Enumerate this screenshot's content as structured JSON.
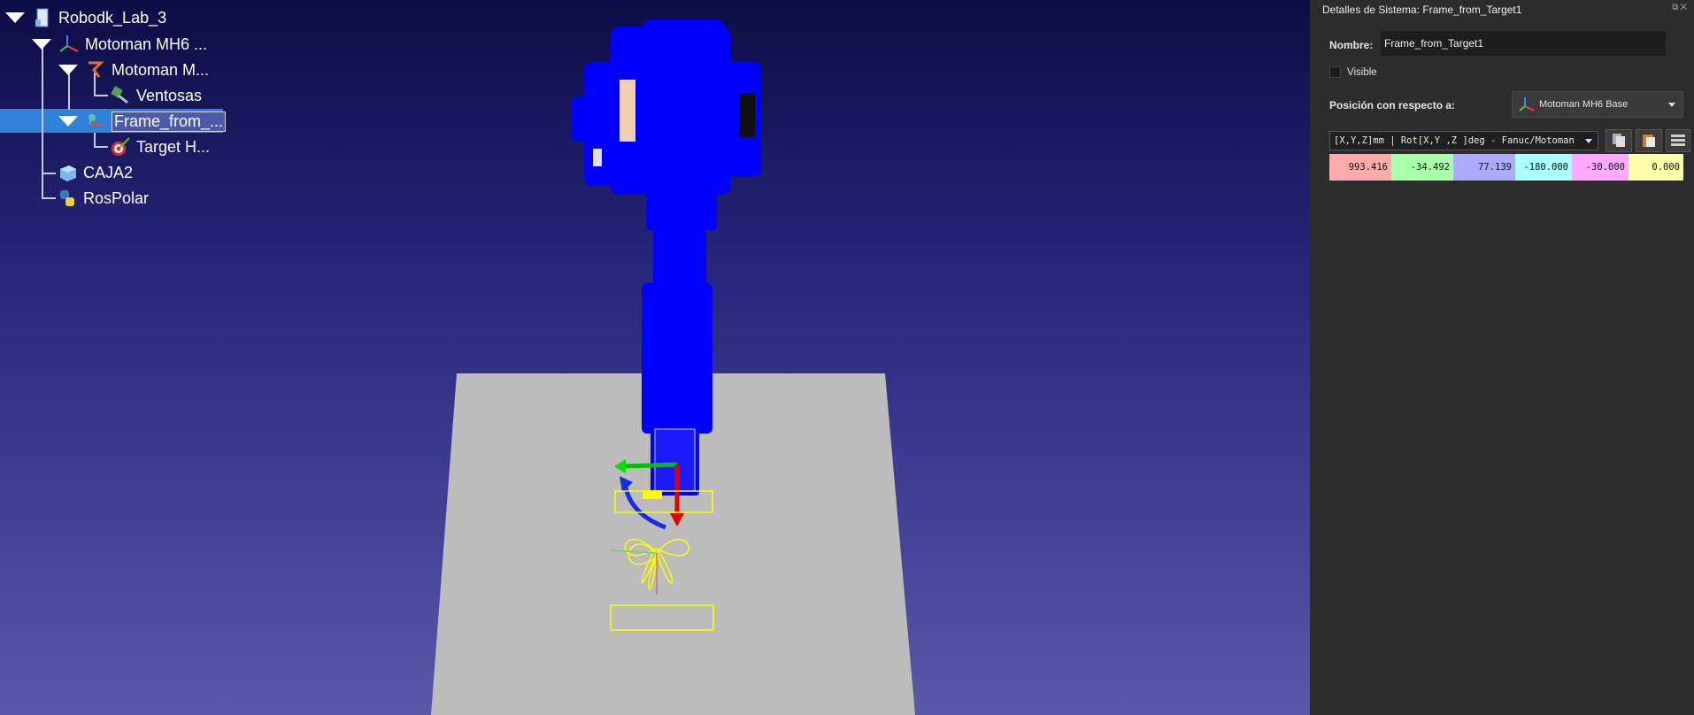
{
  "tree": {
    "items": [
      {
        "label": "Robodk_Lab_3",
        "icon": "station-icon"
      },
      {
        "label": "Motoman MH6 ...",
        "icon": "robot-base-frame-icon"
      },
      {
        "label": "Motoman M...",
        "icon": "robot-icon"
      },
      {
        "label": "Ventosas",
        "icon": "tool-icon"
      },
      {
        "label": "Frame_from_...",
        "icon": "reference-frame-icon"
      },
      {
        "label": "Target H...",
        "icon": "target-icon"
      },
      {
        "label": "CAJA2",
        "icon": "object-icon"
      },
      {
        "label": "RosPolar",
        "icon": "python-icon"
      }
    ]
  },
  "panel": {
    "title": "Detalles de Sistema: Frame_from_Target1",
    "name_label": "Nombre:",
    "name_value": "Frame_from_Target1",
    "visible_label": "Visible",
    "position_label": "Posición con respecto a:",
    "reference_value": "Motoman MH6 Base",
    "format_value": "[X,Y,Z]mm | Rot[X,Y ,Z ]deg - Fanuc/Motoman",
    "pose_values": [
      "993.416",
      "-34.492",
      "77.139",
      "-180.000",
      "-30.000",
      "0.000"
    ],
    "pose_colors": [
      "#ffaaaa",
      "#aaffaa",
      "#aaaaff",
      "#aaffff",
      "#ffaaff",
      "#ffffaa"
    ]
  },
  "scene": {
    "robot_color": "#0000ff",
    "floor_color": "#bcbcbc",
    "path_color": "#ffff00"
  }
}
